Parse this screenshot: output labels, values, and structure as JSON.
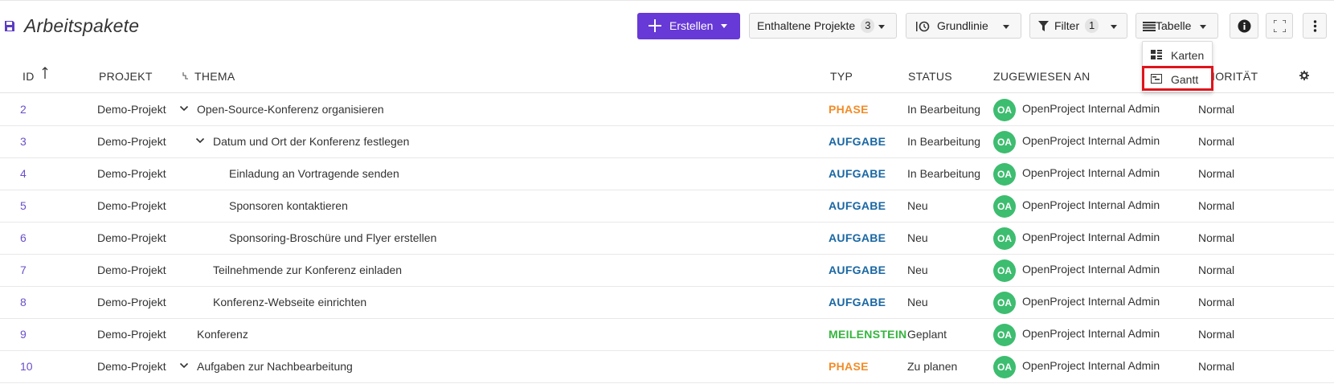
{
  "page": {
    "title": "Arbeitspakete"
  },
  "toolbar": {
    "create_label": "Erstellen",
    "projects_label": "Enthaltene Projekte",
    "projects_count": "3",
    "baseline_label": "Grundlinie",
    "filter_label": "Filter",
    "filter_count": "1",
    "view_label": "Tabelle"
  },
  "view_menu": {
    "items": [
      {
        "label": "Karten",
        "icon": "cards-icon"
      },
      {
        "label": "Gantt",
        "icon": "gantt-icon"
      }
    ],
    "highlight_color": "#e0141c"
  },
  "table": {
    "columns": {
      "id": "ID",
      "project": "PROJEKT",
      "subject": "THEMA",
      "type": "TYP",
      "status": "STATUS",
      "assignee": "ZUGEWIESEN AN",
      "priority": "PRIORITÄT"
    },
    "sort_column": "ID",
    "sort_direction": "ascending",
    "rows": [
      {
        "id": "2",
        "project": "Demo-Projekt",
        "subject": "Open-Source-Konferenz organisieren",
        "level": 0,
        "expandable": true,
        "type": "PHASE",
        "type_color": "#f28c28",
        "status": "In Bearbeitung",
        "avatar": "OA",
        "assignee": "OpenProject Internal Admin",
        "priority": "Normal"
      },
      {
        "id": "3",
        "project": "Demo-Projekt",
        "subject": "Datum und Ort der Konferenz festlegen",
        "level": 1,
        "expandable": true,
        "type": "AUFGABE",
        "type_color": "#1a67a3",
        "status": "In Bearbeitung",
        "avatar": "OA",
        "assignee": "OpenProject Internal Admin",
        "priority": "Normal"
      },
      {
        "id": "4",
        "project": "Demo-Projekt",
        "subject": "Einladung an Vortragende senden",
        "level": 2,
        "expandable": false,
        "type": "AUFGABE",
        "type_color": "#1a67a3",
        "status": "In Bearbeitung",
        "avatar": "OA",
        "assignee": "OpenProject Internal Admin",
        "priority": "Normal"
      },
      {
        "id": "5",
        "project": "Demo-Projekt",
        "subject": "Sponsoren kontaktieren",
        "level": 2,
        "expandable": false,
        "type": "AUFGABE",
        "type_color": "#1a67a3",
        "status": "Neu",
        "avatar": "OA",
        "assignee": "OpenProject Internal Admin",
        "priority": "Normal"
      },
      {
        "id": "6",
        "project": "Demo-Projekt",
        "subject": "Sponsoring-Broschüre und Flyer erstellen",
        "level": 2,
        "expandable": false,
        "type": "AUFGABE",
        "type_color": "#1a67a3",
        "status": "Neu",
        "avatar": "OA",
        "assignee": "OpenProject Internal Admin",
        "priority": "Normal"
      },
      {
        "id": "7",
        "project": "Demo-Projekt",
        "subject": "Teilnehmende zur Konferenz einladen",
        "level": 1,
        "expandable": false,
        "type": "AUFGABE",
        "type_color": "#1a67a3",
        "status": "Neu",
        "avatar": "OA",
        "assignee": "OpenProject Internal Admin",
        "priority": "Normal"
      },
      {
        "id": "8",
        "project": "Demo-Projekt",
        "subject": "Konferenz-Webseite einrichten",
        "level": 1,
        "expandable": false,
        "type": "AUFGABE",
        "type_color": "#1a67a3",
        "status": "Neu",
        "avatar": "OA",
        "assignee": "OpenProject Internal Admin",
        "priority": "Normal"
      },
      {
        "id": "9",
        "project": "Demo-Projekt",
        "subject": "Konferenz",
        "level": 0,
        "expandable": false,
        "type": "MEILENSTEIN",
        "type_color": "#35b53e",
        "status": "Geplant",
        "avatar": "OA",
        "assignee": "OpenProject Internal Admin",
        "priority": "Normal"
      },
      {
        "id": "10",
        "project": "Demo-Projekt",
        "subject": "Aufgaben zur Nachbearbeitung",
        "level": 0,
        "expandable": true,
        "type": "PHASE",
        "type_color": "#f28c28",
        "status": "Zu planen",
        "avatar": "OA",
        "assignee": "OpenProject Internal Admin",
        "priority": "Normal"
      }
    ]
  },
  "colors": {
    "accent": "#6739d6",
    "avatar": "#3dbd6f",
    "id_link": "#6a4fc9"
  }
}
